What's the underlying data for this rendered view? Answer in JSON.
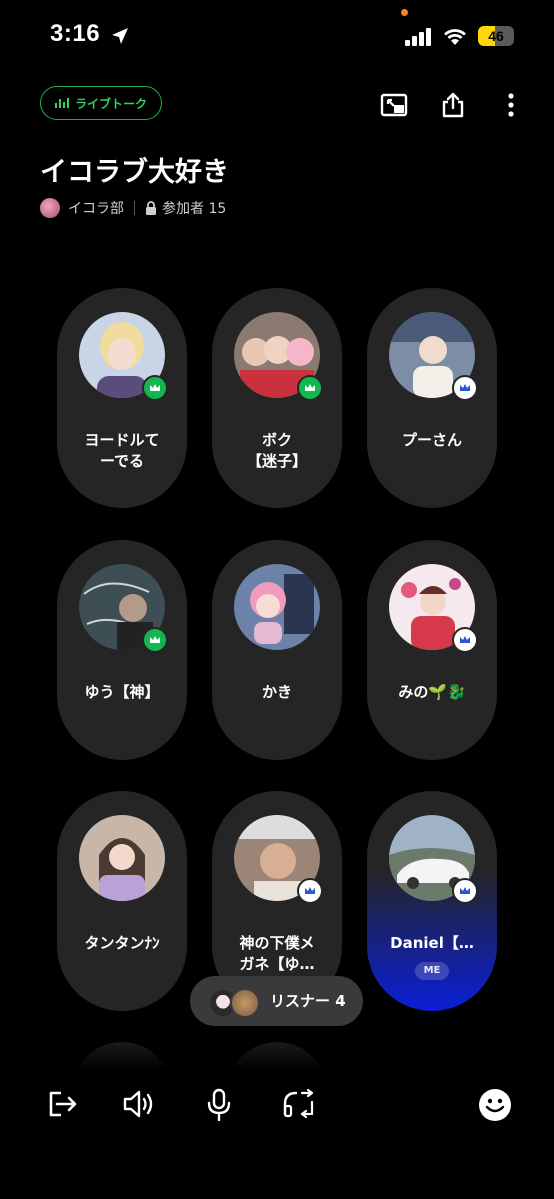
{
  "status_bar": {
    "time": "3:16",
    "battery": "46",
    "battery_level": 0.46
  },
  "header": {
    "live_badge": "ライブトーク",
    "actions": [
      "pip-icon",
      "share-icon",
      "more-icon"
    ]
  },
  "room": {
    "title": "イコラブ大好き",
    "club": "イコラ部",
    "participants": "参加者 15"
  },
  "speakers": [
    {
      "name_line1": "ヨードルて",
      "name_line2": "ーでる",
      "badge": "green"
    },
    {
      "name_line1": "ボク",
      "name_line2": "【迷子】",
      "badge": "green"
    },
    {
      "name_line1": "プーさん",
      "name_line2": "",
      "badge": "blue"
    },
    {
      "name_line1": "ゆう【神】",
      "name_line2": "",
      "badge": "green"
    },
    {
      "name_line1": "かき",
      "name_line2": "",
      "badge": ""
    },
    {
      "name_line1": "みの🌱🐉",
      "name_line2": "",
      "badge": "blue"
    },
    {
      "name_line1": "タンタンﾅﾝ",
      "name_line2": "",
      "badge": ""
    },
    {
      "name_line1": "神の下僕メ",
      "name_line2": "ガネ【ゆ…",
      "badge": "blue"
    },
    {
      "name_line1": "Daniel【…",
      "name_line2": "",
      "badge": "blue",
      "me_label": "ME"
    }
  ],
  "listener": {
    "label": "リスナー 4"
  },
  "bottom_bar": [
    "leave-icon",
    "speaker-icon",
    "mic-icon",
    "headset-switch-icon",
    "emoji-icon"
  ],
  "colors": {
    "accent_green": "#12b84f",
    "me_blue": "#0a1fd8",
    "card": "#252525"
  }
}
